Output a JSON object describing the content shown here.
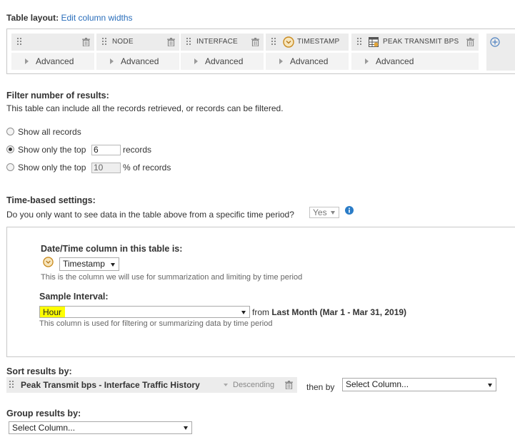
{
  "table_layout": {
    "title": "Table layout:",
    "edit_link": "Edit column widths",
    "columns": [
      {
        "label": "",
        "advanced": "Advanced",
        "icon": "none"
      },
      {
        "label": "NODE",
        "advanced": "Advanced",
        "icon": "none"
      },
      {
        "label": "INTERFACE",
        "advanced": "Advanced",
        "icon": "none"
      },
      {
        "label": "TIMESTAMP",
        "advanced": "Advanced",
        "icon": "clock-badge-icon"
      },
      {
        "label": "PEAK TRANSMIT BPS",
        "advanced": "Advanced",
        "icon": "table-icon"
      }
    ]
  },
  "filter": {
    "title": "Filter number of results:",
    "description": "This table can include all the records retrieved, or records can be filtered.",
    "option_all": "Show all records",
    "option_top_prefix": "Show only the top",
    "option_top_value": "6",
    "option_top_suffix": "records",
    "option_pct_prefix": "Show only the top",
    "option_pct_value": "10",
    "option_pct_suffix": "% of records",
    "selected": "top"
  },
  "time": {
    "title": "Time-based settings:",
    "question": "Do you only want to see data in the table above from a specific time period?",
    "answer": "Yes",
    "datetime_label": "Date/Time column in this table is:",
    "datetime_value": "Timestamp",
    "datetime_help": "This is the column we will use for summarization and limiting by time period",
    "interval_label": "Sample Interval:",
    "interval_value": "Hour",
    "from_text": "from",
    "range_text": "Last Month (Mar 1 - Mar 31, 2019)",
    "interval_help": "This column is used for filtering or summarizing data by time period"
  },
  "sort": {
    "title": "Sort results by:",
    "column": "Peak Transmit bps - Interface Traffic History",
    "direction": "Descending",
    "then_by": "then by",
    "select_placeholder": "Select Column..."
  },
  "group": {
    "title": "Group results by:",
    "select_placeholder": "Select Column..."
  },
  "colors": {
    "link": "#2a6ebb",
    "highlight": "#ffff00",
    "info": "#2a7cc7",
    "clock_badge": "#e2a53a"
  }
}
